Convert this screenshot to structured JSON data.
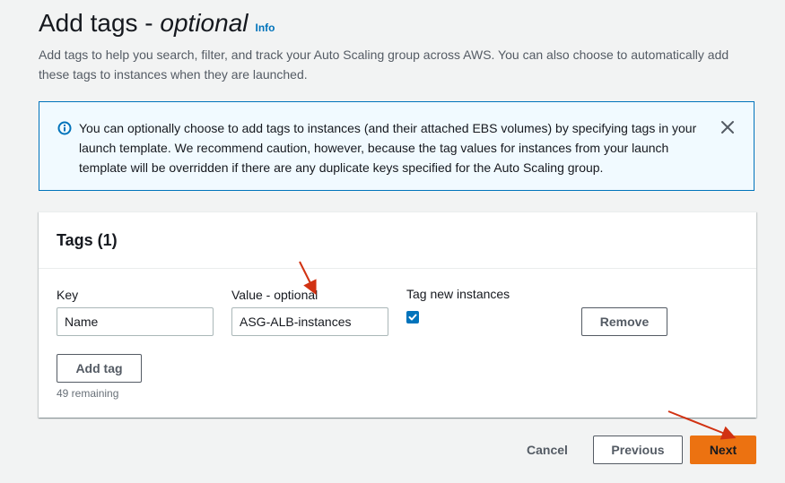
{
  "header": {
    "title_plain": "Add tags - ",
    "title_italic": "optional",
    "info_link": "Info",
    "description": "Add tags to help you search, filter, and track your Auto Scaling group across AWS. You can also choose to automatically add these tags to instances when they are launched."
  },
  "alert": {
    "icon": "info-circle-icon",
    "text": "You can optionally choose to add tags to instances (and their attached EBS volumes) by specifying tags in your launch template. We recommend caution, however, because the tag values for instances from your launch template will be overridden if there are any duplicate keys specified for the Auto Scaling group.",
    "close_icon": "close-icon"
  },
  "tags": {
    "title": "Tags (1)",
    "columns": {
      "key": "Key",
      "value": "Value - optional",
      "tag_new_instances": "Tag new instances"
    },
    "rows": [
      {
        "key": "Name",
        "value": "ASG-ALB-instances",
        "tag_new_instances": true,
        "remove_label": "Remove"
      }
    ],
    "add_tag_label": "Add tag",
    "remaining": "49 remaining"
  },
  "footer": {
    "cancel_label": "Cancel",
    "previous_label": "Previous",
    "next_label": "Next"
  },
  "colors": {
    "accent": "#0073bb",
    "primary_button": "#ec7211",
    "annotation": "#d13212"
  }
}
